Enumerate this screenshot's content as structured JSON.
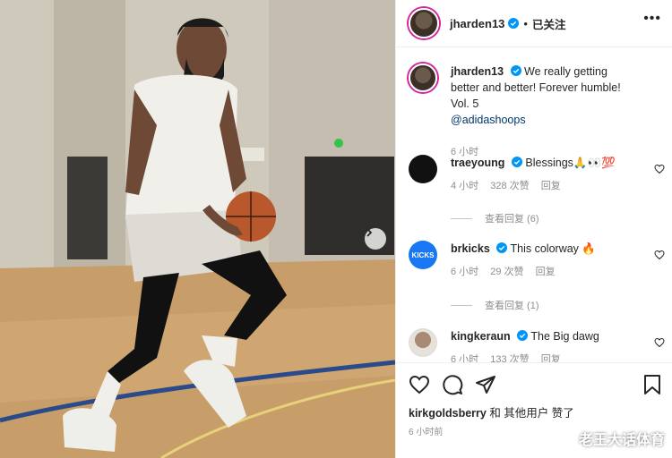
{
  "header": {
    "username": "jharden13",
    "dot": "•",
    "follow_label": "已关注",
    "more": "•••"
  },
  "caption": {
    "username": "jharden13",
    "text": "We really getting better and better! Forever humble! Vol. 5",
    "mention": "@adidashoops",
    "time": "6 小时"
  },
  "comments": [
    {
      "username": "traeyoung",
      "text": "Blessings🙏👀💯",
      "time": "4 小时",
      "likes": "328 次赞",
      "reply": "回复",
      "view_replies": "查看回复 (6)"
    },
    {
      "username": "brkicks",
      "text": "This colorway 🔥",
      "time": "6 小时",
      "likes": "29 次赞",
      "reply": "回复",
      "view_replies": "查看回复 (1)",
      "avatar_text": "KICKS"
    },
    {
      "username": "kingkeraun",
      "text": "The Big dawg",
      "time": "6 小时",
      "likes": "133 次赞",
      "reply": "回复"
    }
  ],
  "footer": {
    "likes_user": "kirkgoldsberry",
    "likes_rest": " 和 其他用户 赞了",
    "time": "6 小时前"
  },
  "watermark": "老王大话体育",
  "colors": {
    "verified": "#0095f6",
    "link": "#00376b",
    "secondary": "#8e8e8e"
  },
  "icons": [
    "heart-icon",
    "comment-icon",
    "share-icon",
    "bookmark-icon",
    "verified-icon",
    "chevron-right-icon"
  ]
}
